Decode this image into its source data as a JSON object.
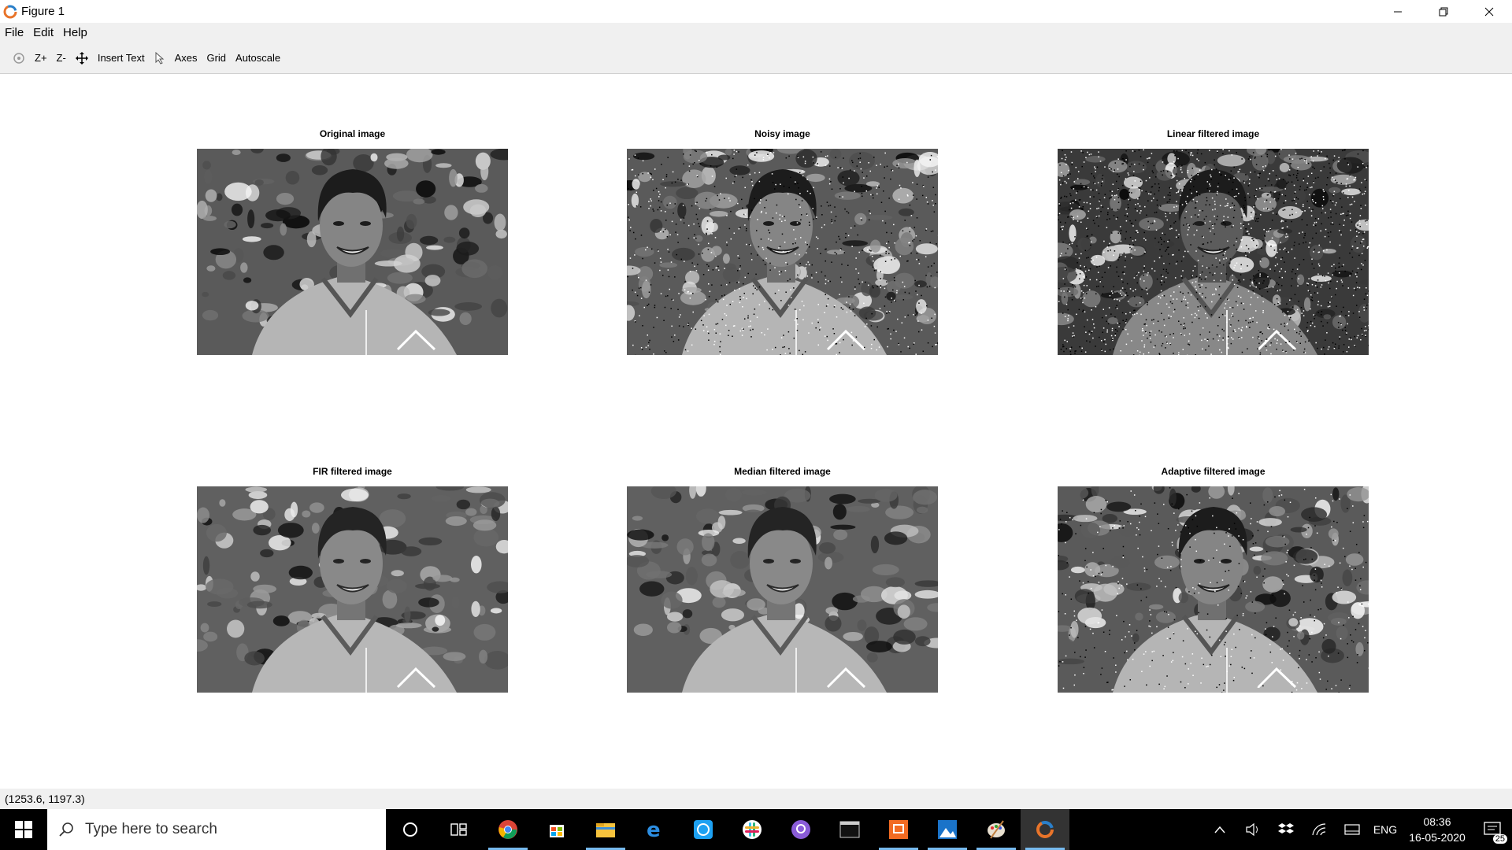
{
  "window": {
    "title": "Figure 1"
  },
  "menu": {
    "items": [
      "File",
      "Edit",
      "Help"
    ]
  },
  "toolbar": {
    "zoom_in": "Z+",
    "zoom_out": "Z-",
    "insert_text": "Insert Text",
    "axes": "Axes",
    "grid": "Grid",
    "autoscale": "Autoscale"
  },
  "figure": {
    "subplots": [
      {
        "title": "Original image",
        "variant": "original"
      },
      {
        "title": "Noisy image",
        "variant": "noisy"
      },
      {
        "title": "Linear filtered image",
        "variant": "linear"
      },
      {
        "title": "FIR filtered image",
        "variant": "fir"
      },
      {
        "title": "Median filtered image",
        "variant": "median"
      },
      {
        "title": "Adaptive filtered image",
        "variant": "adaptive"
      }
    ]
  },
  "status": {
    "coords": "(1253.6, 1197.3)"
  },
  "taskbar": {
    "search_placeholder": "Type here to search",
    "apps": [
      "cortana-icon",
      "task-view-icon",
      "chrome-icon",
      "store-icon",
      "file-explorer-icon",
      "edge-icon",
      "whatsapp-icon",
      "slack-icon",
      "github-icon",
      "terminal-icon",
      "slides-icon",
      "photos-icon",
      "paint-icon",
      "octave-icon"
    ],
    "tray": {
      "language": "ENG",
      "time": "08:36",
      "date": "16-05-2020",
      "notifications": "25"
    }
  },
  "colors": {
    "taskbar_bg": "#000000",
    "toolbar_bg": "#f0f0f0",
    "active_indicator": "#76b9ed"
  }
}
